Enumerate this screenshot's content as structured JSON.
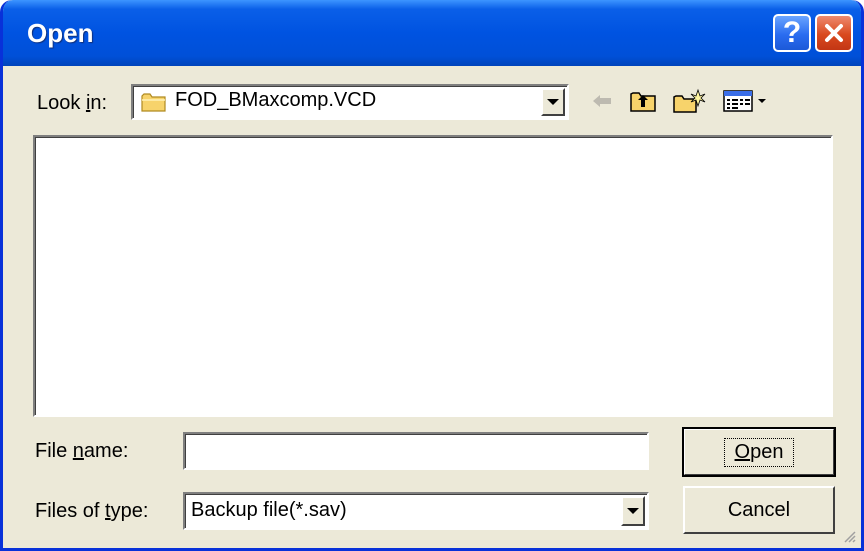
{
  "window": {
    "title": "Open"
  },
  "toolbar": {
    "look_in_label_pre": "Look ",
    "look_in_label_accel": "i",
    "look_in_label_post": "n:",
    "look_in_value": "FOD_BMaxcomp.VCD",
    "look_in_icon": "folder-icon",
    "icons": [
      "back-arrow-icon",
      "up-one-level-icon",
      "new-folder-icon",
      "view-menu-icon"
    ]
  },
  "file_name": {
    "label_pre": "File ",
    "label_accel": "n",
    "label_post": "ame:",
    "value": ""
  },
  "file_type": {
    "label_pre": "Files of ",
    "label_accel": "t",
    "label_post": "ype:",
    "value": "Backup file(*.sav)"
  },
  "buttons": {
    "open_accel": "O",
    "open_rest": "pen",
    "cancel": "Cancel"
  },
  "colors": {
    "titlebar": "#0053e1",
    "dialog_bg": "#ece9d8",
    "close_red": "#d9491e"
  }
}
